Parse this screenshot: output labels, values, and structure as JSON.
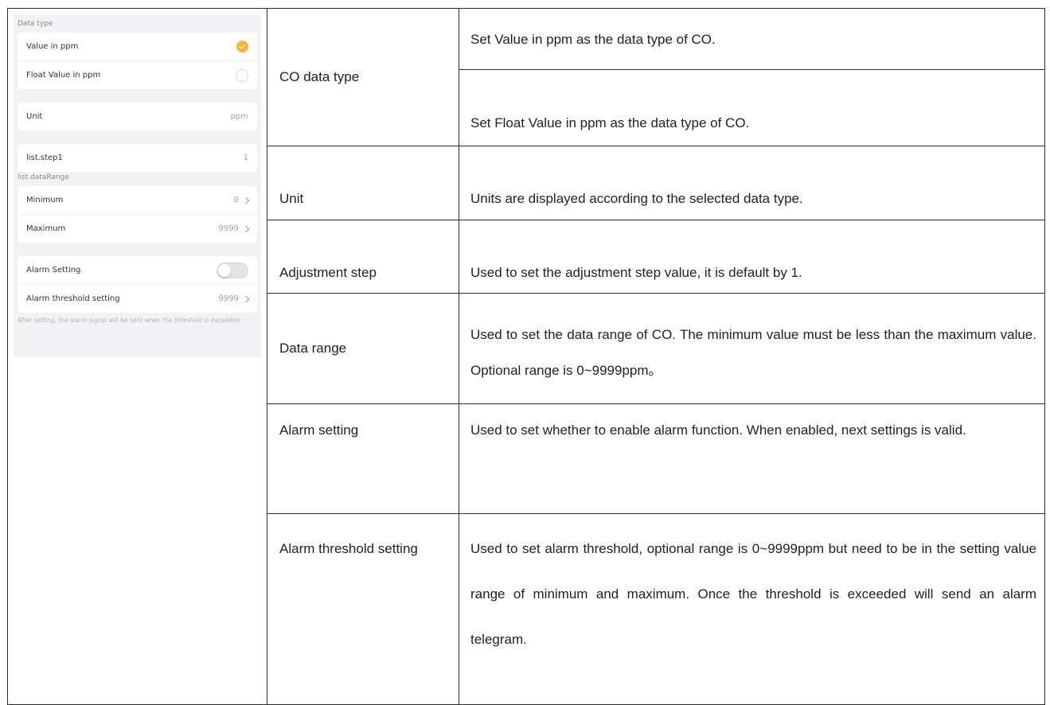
{
  "screenshot": {
    "data_type_header": "Data type",
    "options": [
      {
        "label": "Value in ppm",
        "selected": true
      },
      {
        "label": "Float Value in ppm",
        "selected": false
      }
    ],
    "unit_label": "Unit",
    "unit_value": "ppm",
    "step_label": "list.step1",
    "step_value": "1",
    "range_header": "list.dataRange",
    "minimum_label": "Minimum",
    "minimum_value": "0",
    "maximum_label": "Maximum",
    "maximum_value": "9999",
    "alarm_setting_label": "Alarm Setting",
    "alarm_enabled": false,
    "alarm_threshold_label": "Alarm threshold setting",
    "alarm_threshold_value": "9999",
    "hint_text": "After setting, the alarm signal will be sent when the threshold is exceeded.",
    "accent_color": "#f5b33b"
  },
  "table": {
    "rows": [
      {
        "param": "CO data type",
        "desc": "Set Value in ppm as the data type of CO."
      },
      {
        "desc": "Set Float Value in ppm as the data type of CO."
      },
      {
        "param": "Unit",
        "desc": "Units are displayed according to the selected data type."
      },
      {
        "param": "Adjustment step",
        "desc": "Used to set the adjustment step value, it is default by 1."
      },
      {
        "param": "Data range",
        "desc": "Used to set the data range of CO. The minimum value must be less than the maximum value. Optional range is 0~9999ppm。"
      },
      {
        "param": "Alarm setting",
        "desc": "Used to set whether to enable alarm function. When enabled, next settings is valid."
      },
      {
        "param": "Alarm threshold setting",
        "desc": "Used to set alarm threshold, optional range is 0~9999ppm but need to be in the setting value range of minimum and maximum. Once the threshold is exceeded will send an alarm telegram."
      }
    ]
  }
}
